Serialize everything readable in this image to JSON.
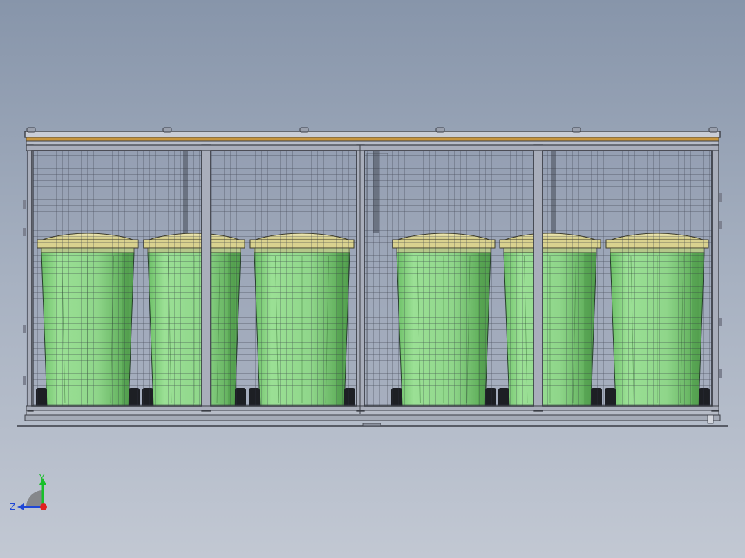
{
  "viewport": {
    "background_top": "#8795aa",
    "background_bottom": "#c2c8d3"
  },
  "model": {
    "component": "bin-enclosure-with-mesh-doors",
    "view": "front",
    "bin_count": 6,
    "door_panel_count": 4,
    "colors": {
      "frame": "#3a3d45",
      "frame_light": "#7c8190",
      "roof_trim": "#c8963e",
      "mesh": "#2e3240",
      "bin_body": "#8fd68a",
      "bin_body_shade": "#5fae5a",
      "bin_lid": "#e6dfa0",
      "wheel": "#1d1f24"
    }
  },
  "triad": {
    "y_label": "Y",
    "z_label": "Z",
    "y_color": "#18c02a",
    "z_color": "#1f47d6",
    "x_color": "#e02020"
  }
}
